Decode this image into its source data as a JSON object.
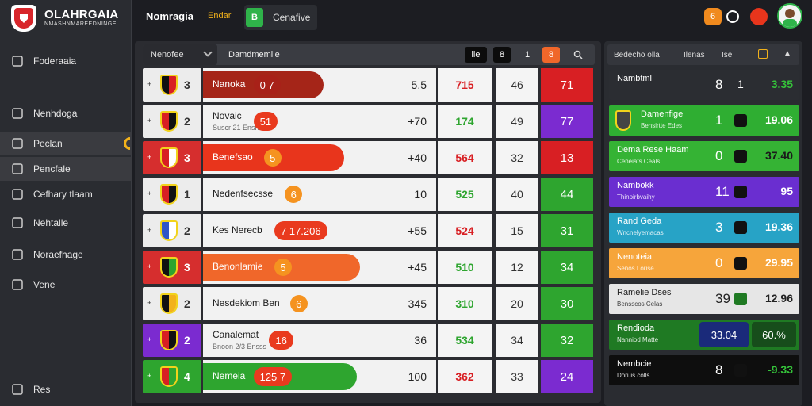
{
  "brand": {
    "name": "OLAHRGAIA",
    "tagline": "NMASHNMAREEDNINGE"
  },
  "sidebar": {
    "items": [
      {
        "label": "Foderaaia",
        "icon": "list-icon"
      },
      {
        "label": "Nenhdoga",
        "icon": "square-icon"
      },
      {
        "label": "Peclan",
        "icon": "home-icon"
      },
      {
        "label": "Pencfale",
        "icon": "settings-icon"
      },
      {
        "label": "Cefhary tlaam",
        "icon": "circle-icon"
      },
      {
        "label": "Nehtalle",
        "icon": "info-icon"
      },
      {
        "label": "Noraefhage",
        "icon": "grid-icon"
      },
      {
        "label": "Vene",
        "icon": "diamond-icon"
      },
      {
        "label": "Res",
        "icon": "user-icon"
      }
    ]
  },
  "topbar": {
    "title": "Nomragia",
    "subtitle": "Endar",
    "chip_icon": "B",
    "chip_label": "Cenafive"
  },
  "panel": {
    "select": "Nenofee",
    "heading": "Damdmemiie",
    "btn1": "lle",
    "btn2": "8",
    "btn3": "1",
    "btn4": "8"
  },
  "rows": [
    {
      "pos": "3",
      "name": "Nanoka",
      "badge": "0 7",
      "val": "5.5",
      "c3": "715",
      "c4": "46",
      "c5": "71",
      "c5col": "#d81f23",
      "c1": "light",
      "bar": "#a52518",
      "barw": 152,
      "namecls": "bw"
    },
    {
      "pos": "2",
      "name": "Novaic",
      "sub": "Suscr 21 Ensns",
      "badge": "51",
      "val": "+70",
      "c3": "174",
      "c4": "49",
      "c5": "77",
      "c5col": "#7b2bd0",
      "c1": "light",
      "bar": "",
      "barw": 0
    },
    {
      "pos": "3",
      "name": "Benefsao",
      "badge": "5",
      "val": "+40",
      "c3": "564",
      "c4": "32",
      "c5": "13",
      "c5col": "#d81f23",
      "c1": "red",
      "bar": "#e8351c",
      "barw": 178,
      "badgeCircle": true,
      "namecls": "bw"
    },
    {
      "pos": "1",
      "name": "Nedenfsecsse",
      "badge": "6",
      "val": "10",
      "c3": "525",
      "c4": "40",
      "c5": "44",
      "c5col": "#2ea52f",
      "c1": "light",
      "bar": "",
      "barw": 0,
      "badgeCircle": true
    },
    {
      "pos": "2",
      "name": "Kes Nerecb",
      "badge": "7 17.206",
      "val": "+55",
      "c3": "524",
      "c4": "15",
      "c5": "31",
      "c5col": "#2ea52f",
      "c1": "light",
      "bar": "",
      "barw": 0
    },
    {
      "pos": "3",
      "name": "Benonlamie",
      "badge": "5",
      "val": "+45",
      "c3": "510",
      "c4": "12",
      "c5": "34",
      "c5col": "#2ea52f",
      "c1": "red",
      "bar": "#f0672a",
      "barw": 198,
      "badgeCircle": true
    },
    {
      "pos": "2",
      "name": "Nesdekiom Ben",
      "badge": "6",
      "val": "345",
      "c3": "310",
      "c4": "20",
      "c5": "30",
      "c5col": "#2ea52f",
      "c1": "light",
      "bar": "",
      "barw": 0,
      "badgeCircle": true
    },
    {
      "pos": "2",
      "name": "Canalemat",
      "sub": "Bnoon 2/3 Ensss",
      "badge": "16",
      "val": "36",
      "c3": "534",
      "c4": "34",
      "c5": "32",
      "c5col": "#2ea52f",
      "c1": "purple",
      "bar": "",
      "barw": 0
    },
    {
      "pos": "4",
      "name": "Nemeia",
      "badge": "125 7",
      "val": "100",
      "c3": "362",
      "c4": "33",
      "c5": "24",
      "c5col": "#7b2bd0",
      "c1": "green",
      "bar": "#2ea52f",
      "barw": 194,
      "namecls": "bw"
    }
  ],
  "right": {
    "header": [
      "Bedecho olla",
      "Ilenas",
      "Ise"
    ],
    "rows": [
      {
        "n": "Nambtml",
        "a": "8",
        "b": "1",
        "c": "3.35",
        "bg": "#2b2d32",
        "nc": "#fff",
        "cc": "#35c23a"
      },
      {
        "n": "Damenfigel",
        "s": "Bensirtte Edes",
        "a": "1",
        "c": "19.06",
        "bg": "#2fae32",
        "nc": "#fff",
        "cc": "#fff"
      },
      {
        "n": "Dema Rese Haam",
        "s": "Ceneiats Ceals",
        "a": "0",
        "c": "37.40",
        "bg": "#35b334",
        "nc": "#fff",
        "cc": "#1b1b1b"
      },
      {
        "n": "Nambokk",
        "s": "Thinoirbvaihy",
        "a": "11",
        "c": "95",
        "bg": "#6a2ed0",
        "nc": "#fff",
        "cc": "#fff"
      },
      {
        "n": "Rand Geda",
        "s": "Wncnelyemacas",
        "a": "3",
        "c": "19.36",
        "bg": "#27a3c6",
        "nc": "#fff",
        "cc": "#fff"
      },
      {
        "n": "Nenoteia",
        "s": "Senos Lorise",
        "a": "0",
        "c": "29.95",
        "bg": "#f6a53b",
        "nc": "#fff",
        "cc": "#fff"
      },
      {
        "n": "Ramelie Dses",
        "s": "Bensscos Celas",
        "a": "39",
        "c": "12.96",
        "bg": "#e6e6e6",
        "nc": "#222",
        "cc": "#222"
      },
      {
        "n": "Rendioda",
        "s": "Nanniod Matte",
        "a": "33.04",
        "c": "60.%",
        "bg": "#1f7a23",
        "nc": "#fff",
        "cc": "#fff"
      },
      {
        "n": "Nembcie",
        "s": "Doruis colls",
        "a": "8",
        "c": "-9.33",
        "bg": "#0e0e0e",
        "nc": "#fff",
        "cc": "#35c23a"
      }
    ]
  }
}
